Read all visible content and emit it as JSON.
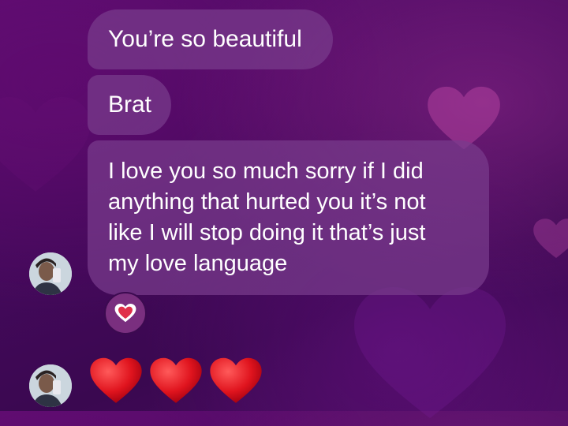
{
  "messages": [
    {
      "text": "You’re so beautiful"
    },
    {
      "text": "Brat"
    },
    {
      "text": "I love you so much sorry if I did\nanything that hurted you it’s not\nlike I will stop doing it that’s just\nmy love language"
    }
  ],
  "reaction": {
    "icon": "heart-reaction-icon"
  },
  "emoji_message": {
    "icons": [
      "red-heart-icon",
      "red-heart-icon",
      "red-heart-icon"
    ]
  },
  "colors": {
    "bubble": "#784a8c",
    "heart_red": "#e0141e",
    "background": "#4a0c60"
  }
}
